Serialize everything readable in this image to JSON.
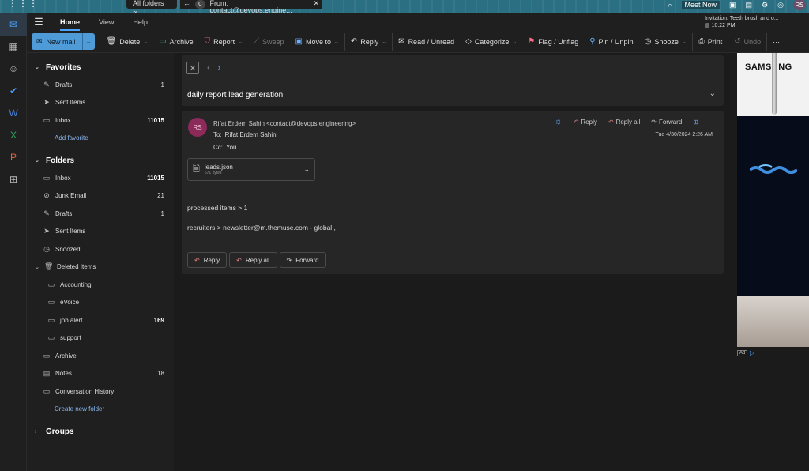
{
  "topbar": {
    "folder_scope": "All folders",
    "search_chip": "From: contact@devops.engine...",
    "meet_now": "Meet Now",
    "avatar_initials": "RS"
  },
  "ribbon": {
    "tabs": [
      "Home",
      "View",
      "Help"
    ],
    "invitation": "Invitation: Teeth brush and o...",
    "invitation_time": "10:22 PM",
    "new_mail": "New mail",
    "actions": {
      "delete": "Delete",
      "archive": "Archive",
      "report": "Report",
      "sweep": "Sweep",
      "move_to": "Move to",
      "reply": "Reply",
      "read_unread": "Read / Unread",
      "categorize": "Categorize",
      "flag": "Flag / Unflag",
      "pin": "Pin / Unpin",
      "snooze": "Snooze",
      "print": "Print",
      "undo": "Undo",
      "more": "···"
    }
  },
  "folders": {
    "favorites_title": "Favorites",
    "favorites": [
      {
        "label": "Drafts",
        "count": "1",
        "icon": "pencil-icon"
      },
      {
        "label": "Sent Items",
        "count": "",
        "icon": "send-icon"
      },
      {
        "label": "Inbox",
        "count": "11015",
        "icon": "inbox-icon"
      }
    ],
    "add_favorite": "Add favorite",
    "folders_title": "Folders",
    "items": [
      {
        "label": "Inbox",
        "count": "11015"
      },
      {
        "label": "Junk Email",
        "count": "21"
      },
      {
        "label": "Drafts",
        "count": "1"
      },
      {
        "label": "Sent Items",
        "count": ""
      },
      {
        "label": "Snoozed",
        "count": ""
      },
      {
        "label": "Deleted Items",
        "count": ""
      },
      {
        "label": "Accounting",
        "count": ""
      },
      {
        "label": "eVoice",
        "count": ""
      },
      {
        "label": "job alert",
        "count": "169"
      },
      {
        "label": "support",
        "count": ""
      },
      {
        "label": "Archive",
        "count": ""
      },
      {
        "label": "Notes",
        "count": "18"
      },
      {
        "label": "Conversation History",
        "count": ""
      }
    ],
    "create_new_folder": "Create new folder",
    "groups_title": "Groups"
  },
  "message": {
    "subject": "daily report lead generation",
    "sender_initials": "RS",
    "from": "Rifat Erdem Sahin <contact@devops.engineering>",
    "to_label": "To:",
    "to": "Rifat Erdem Sahin",
    "cc_label": "Cc:",
    "cc": "You",
    "reply": "Reply",
    "reply_all": "Reply all",
    "forward": "Forward",
    "date": "Tue 4/30/2024 2:26 AM",
    "attachment_name": "leads.json",
    "attachment_size": "671 bytes",
    "body_line1": "processed items > 1",
    "body_line2": "recruiters > newsletter@m.themuse.com - global ,"
  },
  "ad": {
    "brand": "SAMSUNG",
    "badge": "Ad"
  }
}
